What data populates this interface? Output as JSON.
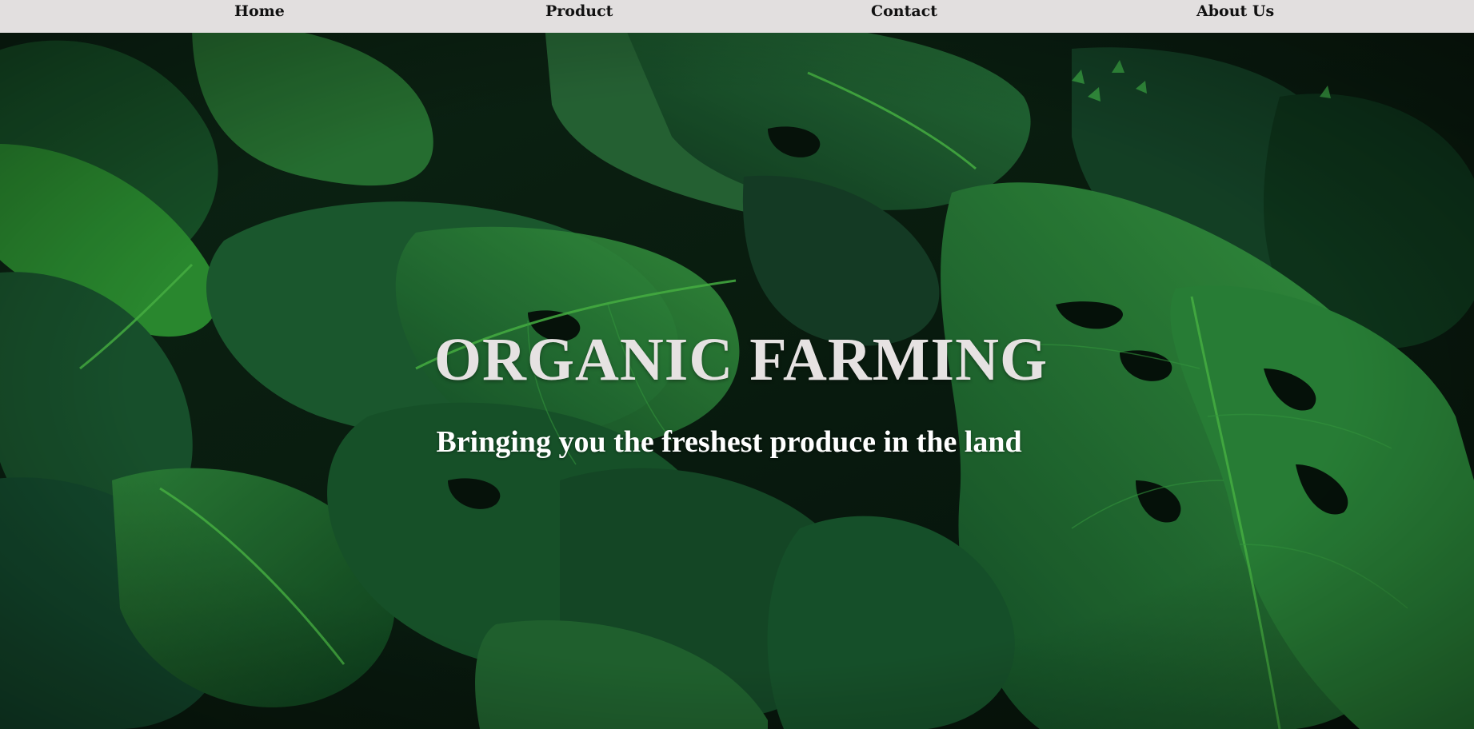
{
  "nav": {
    "items": [
      {
        "label": "Home"
      },
      {
        "label": "Product"
      },
      {
        "label": "Contact"
      },
      {
        "label": "About Us"
      }
    ]
  },
  "hero": {
    "title": "ORGANIC FARMING",
    "subtitle": "Bringing you the freshest produce in the land",
    "background_image": "monstera-leaves-photo"
  },
  "colors": {
    "nav_background": "#e2dfdf",
    "nav_text": "#111111",
    "title_text": "#e6e2e2",
    "subtitle_text": "#ffffff",
    "leaf_dark": "#0f3a1e",
    "leaf_mid": "#1f6b35",
    "leaf_light": "#3fae3a"
  }
}
